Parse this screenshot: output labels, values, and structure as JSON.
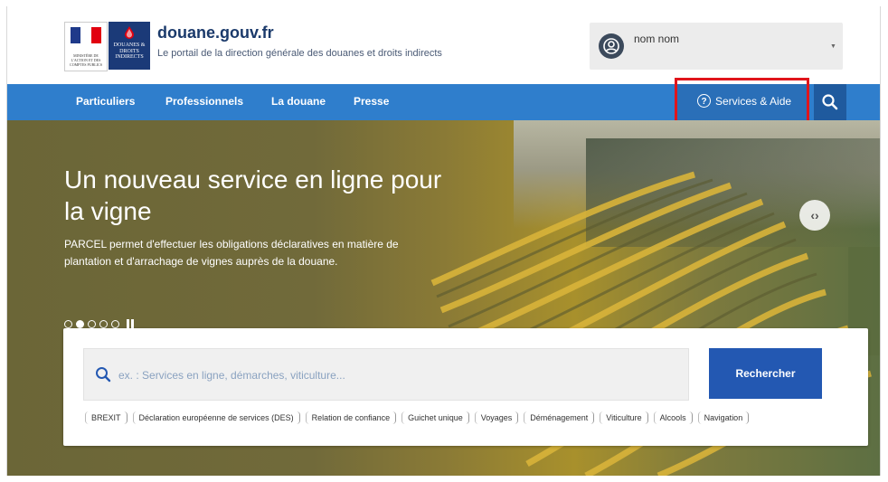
{
  "header": {
    "site_title": "douane.gouv.fr",
    "site_subtitle": "Le portail de la direction générale des douanes et droits indirects",
    "logo_marianne_text": "MINISTÈRE DE L'ACTION ET DES COMPTES PUBLICS",
    "logo_ddfip_text": "DOUANES & DROITS INDIRECTS",
    "user": {
      "name": "nom nom",
      "avatar_icon": "user-circle-icon",
      "dropdown_icon": "caret-down-icon"
    }
  },
  "nav": {
    "items": [
      {
        "label": "Particuliers"
      },
      {
        "label": "Professionnels"
      },
      {
        "label": "La douane"
      },
      {
        "label": "Presse"
      }
    ],
    "services_label": "Services & Aide",
    "services_icon": "question-circle-icon",
    "search_icon": "search-icon"
  },
  "hero": {
    "title": "Un nouveau service en ligne pour la vigne",
    "text": "PARCEL permet d'effectuer les obligations déclaratives en matière de plantation et d'arrachage de vignes auprès de la douane.",
    "slides_count": 5,
    "active_slide": 2,
    "next_icon": "code-arrows-icon"
  },
  "search": {
    "placeholder": "ex. : Services en ligne, démarches, viticulture...",
    "button_label": "Rechercher",
    "tags": [
      "BREXIT",
      "Déclaration européenne de services (DES)",
      "Relation de confiance",
      "Guichet unique",
      "Voyages",
      "Déménagement",
      "Viticulture",
      "Alcools",
      "Navigation"
    ]
  },
  "colors": {
    "nav_bg": "#2f7ecc",
    "highlight": "#e0151b",
    "button": "#2358b2",
    "title": "#1b3a6b"
  }
}
